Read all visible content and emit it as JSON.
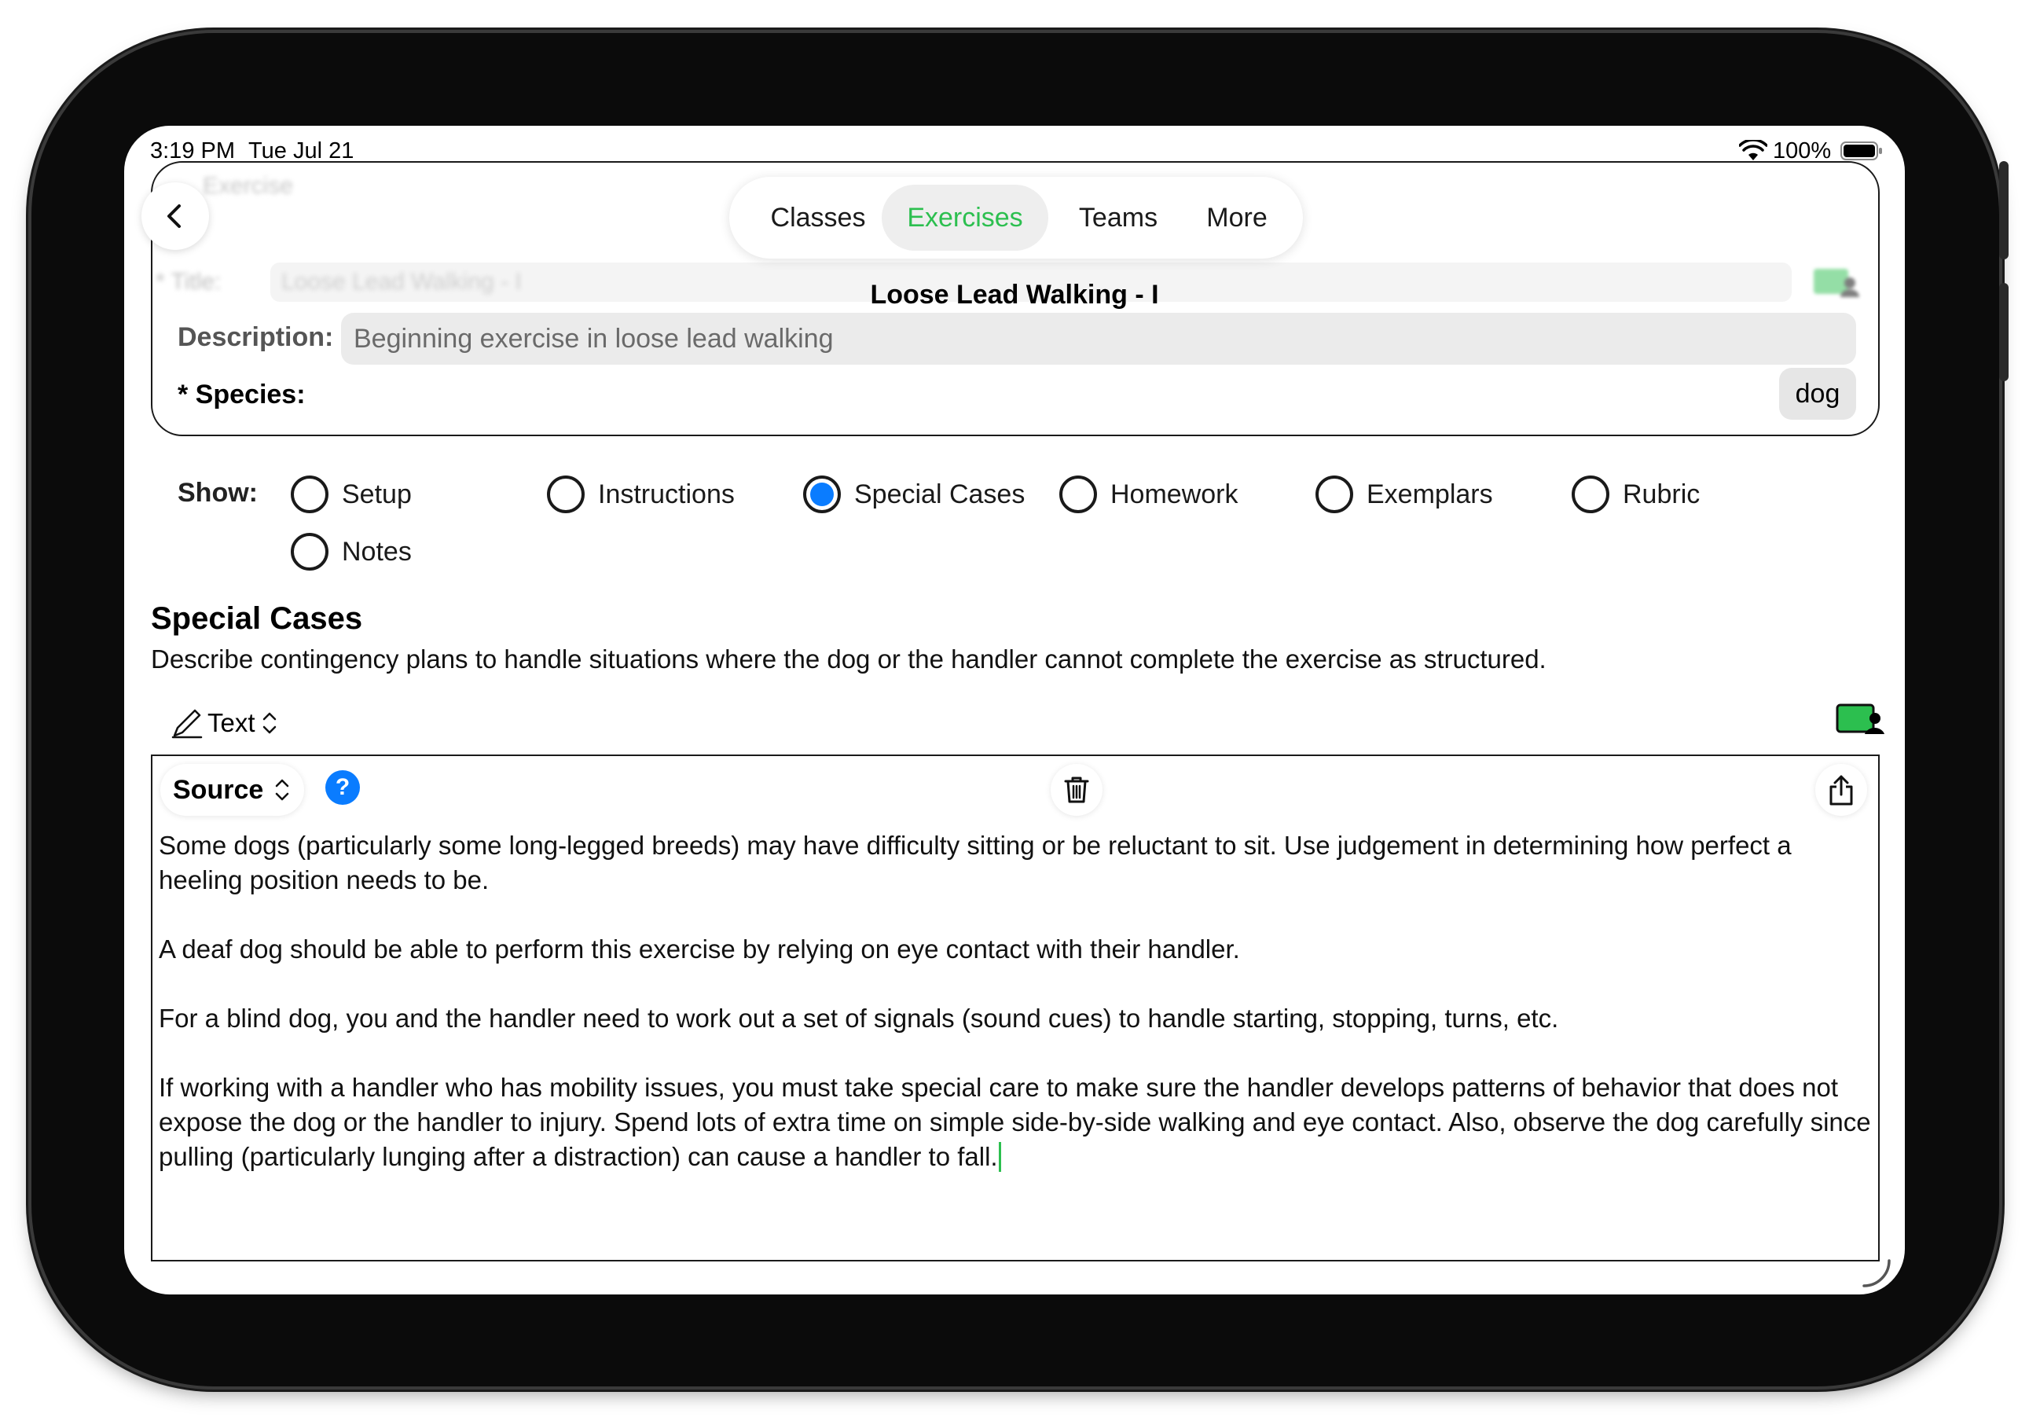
{
  "status_bar": {
    "time": "3:19 PM",
    "date": "Tue Jul 21",
    "battery": "100%"
  },
  "header": {
    "blurred_section_label": "Exercise",
    "blurred_title_label": "* Title:",
    "blurred_title_value": "Loose Lead Walking - I",
    "exercise_title": "Loose Lead Walking - I",
    "description_label": "Description:",
    "description_value": "Beginning exercise in loose lead walking",
    "species_label": "* Species:",
    "species_value": "dog"
  },
  "tabs": [
    {
      "label": "Classes",
      "active": false
    },
    {
      "label": "Exercises",
      "active": true
    },
    {
      "label": "Teams",
      "active": false
    },
    {
      "label": "More",
      "active": false
    }
  ],
  "show": {
    "label": "Show:",
    "options": [
      {
        "label": "Setup",
        "selected": false
      },
      {
        "label": "Instructions",
        "selected": false
      },
      {
        "label": "Special Cases",
        "selected": true
      },
      {
        "label": "Homework",
        "selected": false
      },
      {
        "label": "Exemplars",
        "selected": false
      },
      {
        "label": "Rubric",
        "selected": false
      },
      {
        "label": "Notes",
        "selected": false
      }
    ]
  },
  "section": {
    "title": "Special Cases",
    "description": "Describe contingency plans to handle situations where the dog or the handler cannot complete the exercise as structured."
  },
  "editor": {
    "mode_label": "Text",
    "source_label": "Source",
    "help_label": "?",
    "paragraphs": [
      "Some dogs (particularly some long-legged breeds) may have difficulty sitting or be reluctant to sit. Use judgement in determining how perfect a heeling position needs to be.",
      "A deaf dog should be able to perform this exercise by relying on eye contact with their handler.",
      "For a blind dog, you and the handler need to work out a set of signals (sound cues) to handle starting, stopping, turns, etc.",
      "If working with a handler who has mobility issues, you must take special care to make sure the handler develops patterns of behavior that does not expose the dog or the handler to injury. Spend lots of extra time on simple side-by-side walking and eye contact. Also, observe the dog carefully since pulling (particularly lunging after a distraction) can cause a handler to fall."
    ]
  },
  "colors": {
    "accent_green": "#2cbf4f",
    "selected_blue": "#0a7cff"
  },
  "icons": [
    "back-chevron-icon",
    "wifi-icon",
    "battery-icon",
    "pencil-icon",
    "chevron-up-down-icon",
    "help-icon",
    "trash-icon",
    "share-icon",
    "photo-person-icon"
  ]
}
